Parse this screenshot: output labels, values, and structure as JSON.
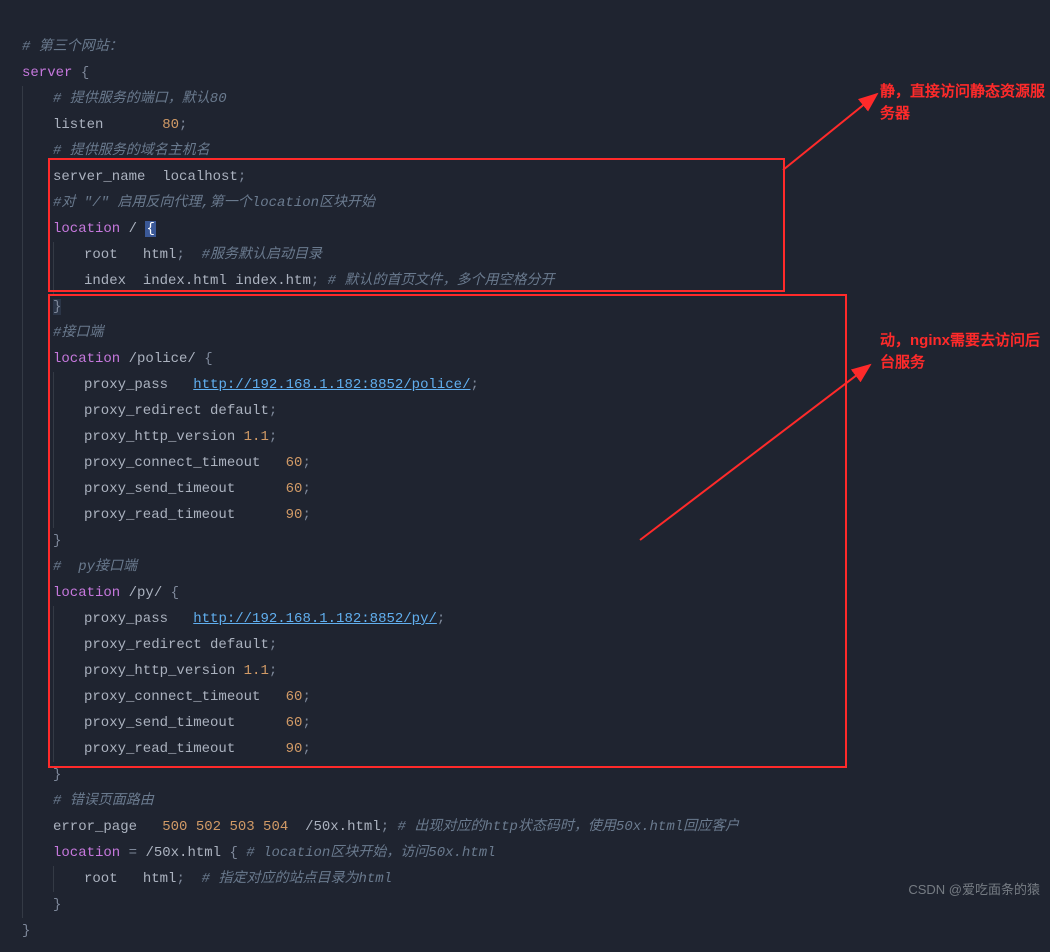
{
  "code": {
    "comment_site3": "# 第三个网站：",
    "kw_server": "server",
    "brace_open": "{",
    "brace_close": "}",
    "comment_port": "# 提供服务的端口，默认80",
    "dir_listen": "listen",
    "listen_value": "80",
    "semi": ";",
    "comment_host": "# 提供服务的域名主机名",
    "dir_servername": "server_name",
    "servername_value": "localhost",
    "comment_loc1": "#对 \"/\" 启用反向代理,第一个location区块开始",
    "kw_location": "location",
    "loc1_path": "/",
    "dir_root": "root",
    "root_value": "html",
    "comment_root": "#服务默认启动目录",
    "dir_index": "index",
    "index_value": "index.html index.htm",
    "comment_index": "# 默认的首页文件，多个用空格分开",
    "comment_api": "#接口端",
    "loc2_path": "/police/",
    "dir_proxy_pass": "proxy_pass",
    "proxy_pass_police": "http://192.168.1.182:8852/police/",
    "dir_proxy_redirect": "proxy_redirect",
    "proxy_redirect_value": "default",
    "dir_proxy_http_version": "proxy_http_version",
    "proxy_http_version_value": "1.1",
    "dir_proxy_connect_timeout": "proxy_connect_timeout",
    "timeout_60": "60",
    "dir_proxy_send_timeout": "proxy_send_timeout",
    "dir_proxy_read_timeout": "proxy_read_timeout",
    "timeout_90": "90",
    "comment_pyapi": "#  py接口端",
    "loc3_path": "/py/",
    "proxy_pass_py": "http://192.168.1.182:8852/py/",
    "comment_errorroute": "# 错误页面路由",
    "dir_error_page": "error_page",
    "error_codes": "500 502 503 504",
    "error_path": "/50x.html",
    "comment_errorpage": "# 出现对应的http状态码时，使用50x.html回应客户",
    "loc_eq": "=",
    "loc4_path": "/50x.html",
    "comment_loc4": "# location区块开始，访问50x.html",
    "comment_root2": "# 指定对应的站点目录为html"
  },
  "annotations": {
    "static_label": "静，直接访问静态资源服务器",
    "dynamic_label": "动，nginx需要去访问后台服务"
  },
  "watermark": "CSDN @爱吃面条的猿"
}
